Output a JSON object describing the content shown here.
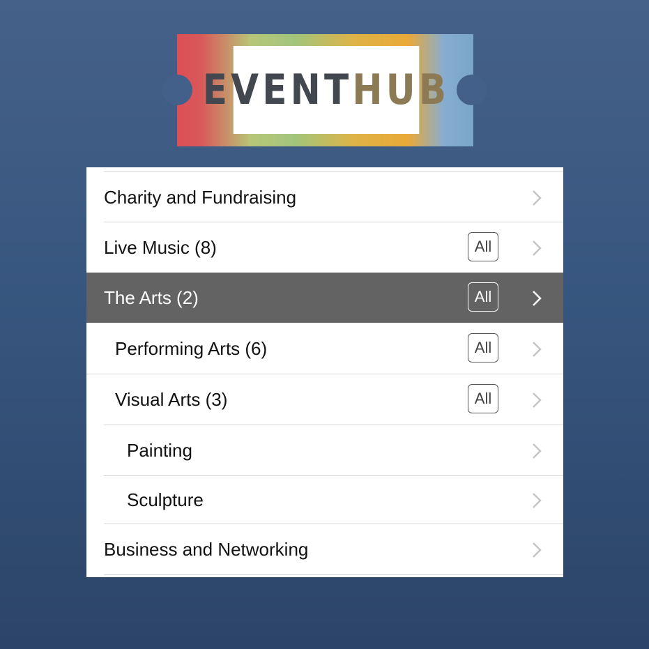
{
  "logo": {
    "part1": "EVENT",
    "part2": "HUB"
  },
  "categories": [
    {
      "label": "Charity and Fundraising",
      "has_all": false,
      "selected": false
    },
    {
      "label": "Live Music (8)",
      "has_all": true,
      "selected": false
    },
    {
      "label": "The Arts (2)",
      "has_all": true,
      "selected": true
    },
    {
      "label": "Performing Arts (6)",
      "has_all": true,
      "selected": false
    },
    {
      "label": "Visual Arts (3)",
      "has_all": true,
      "selected": false
    },
    {
      "label": "Painting",
      "has_all": false,
      "selected": false
    },
    {
      "label": "Sculpture",
      "has_all": false,
      "selected": false
    },
    {
      "label": "Business and Networking",
      "has_all": false,
      "selected": false
    }
  ],
  "all_button_label": "All",
  "colors": {
    "background": "#3a5882",
    "selected_row": "#636363",
    "logo_event": "#43474f",
    "logo_hub": "#8c7a55"
  }
}
